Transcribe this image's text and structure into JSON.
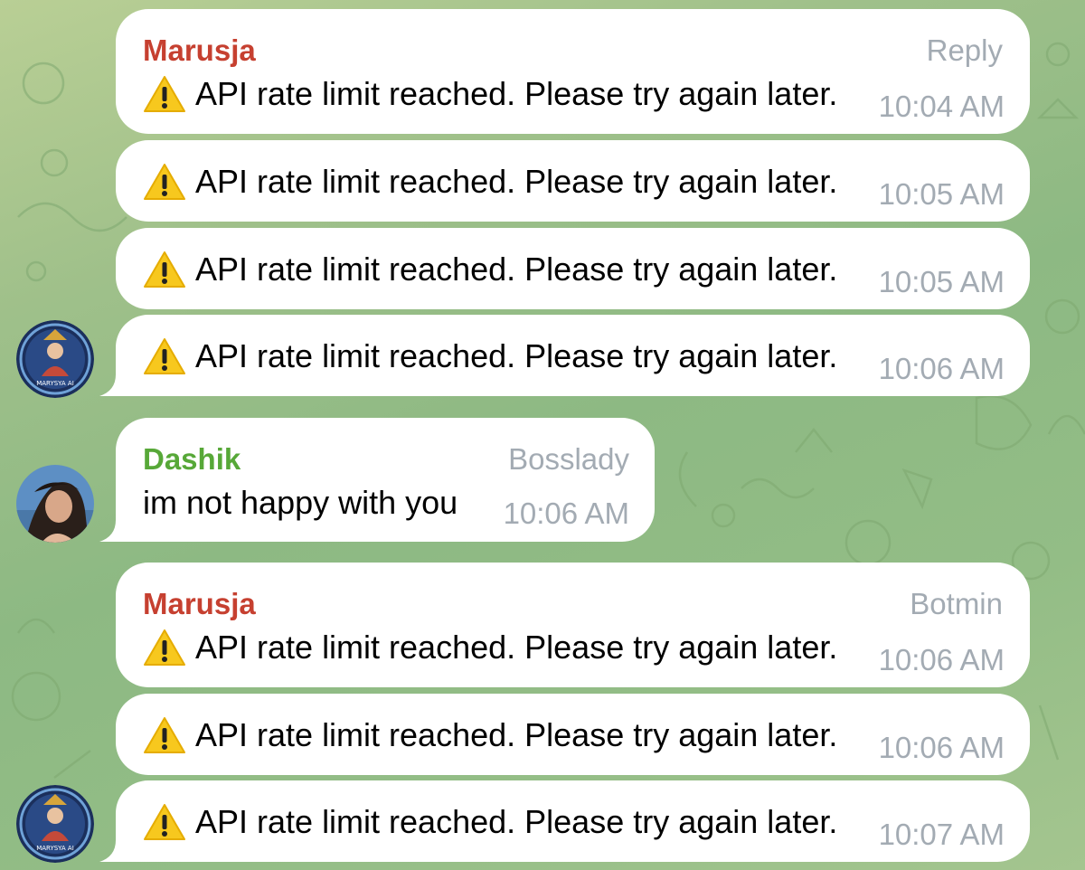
{
  "chat": {
    "colors": {
      "background_top": "#b9cf95",
      "background_bottom": "#8db983",
      "bubble": "#ffffff",
      "sender_red": "#c64030",
      "sender_green": "#57a838",
      "meta_gray": "#a3abb3"
    },
    "messages": [
      {
        "sender": "Marusja",
        "role": "Reply",
        "text": "API rate limit reached. Please try again later.",
        "time": "10:04 AM",
        "icon": "warning-icon"
      },
      {
        "text": "API rate limit reached. Please try again later.",
        "time": "10:05 AM",
        "icon": "warning-icon"
      },
      {
        "text": "API rate limit reached. Please try again later.",
        "time": "10:05 AM",
        "icon": "warning-icon"
      },
      {
        "text": "API rate limit reached. Please try again later.",
        "time": "10:06 AM",
        "icon": "warning-icon"
      },
      {
        "sender": "Dashik",
        "role": "Bosslady",
        "text": "im not happy with you",
        "time": "10:06 AM"
      },
      {
        "sender": "Marusja",
        "role": "Botmin",
        "text": "API rate limit reached. Please try again later.",
        "time": "10:06 AM",
        "icon": "warning-icon"
      },
      {
        "text": "API rate limit reached. Please try again later.",
        "time": "10:06 AM",
        "icon": "warning-icon"
      },
      {
        "text": "API rate limit reached. Please try again later.",
        "time": "10:07 AM",
        "icon": "warning-icon"
      }
    ],
    "avatars": {
      "marusja_caption": "MARYSYA AI"
    }
  }
}
